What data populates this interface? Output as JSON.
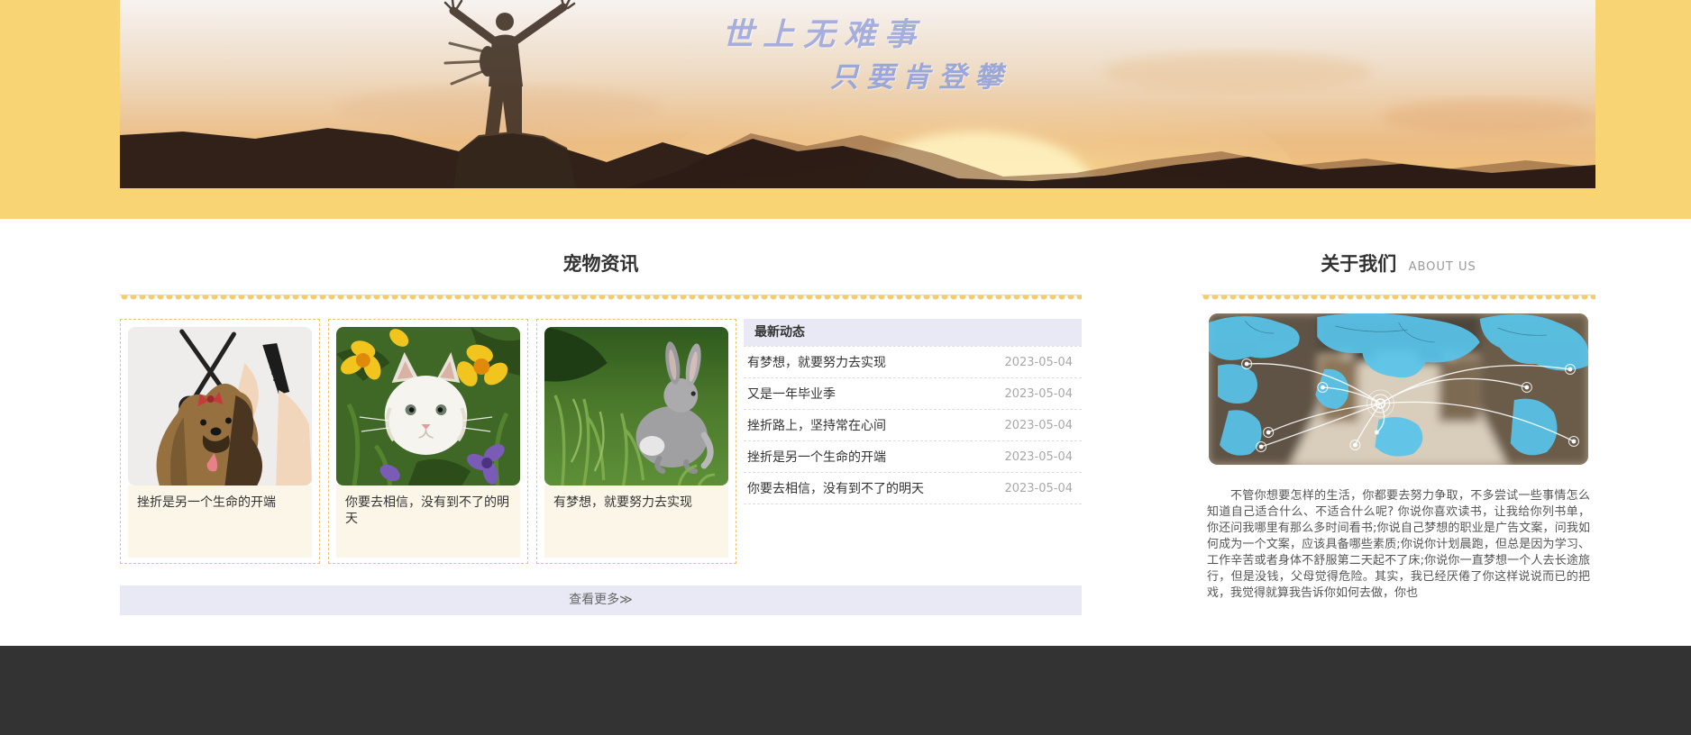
{
  "banner": {
    "slogan_line1": "世上无难事",
    "slogan_line2": "只要肯登攀",
    "image": "hiker-sunset-mountain-photo"
  },
  "pet_news": {
    "title": "宠物资讯",
    "cards": [
      {
        "image": "dog-grooming-photo",
        "caption": "挫折是另一个生命的开端"
      },
      {
        "image": "white-cat-flowers-photo",
        "caption": "你要去相信，没有到不了的明天"
      },
      {
        "image": "gray-rabbit-grass-photo",
        "caption": "有梦想，就要努力去实现"
      }
    ],
    "latest": {
      "header": "最新动态",
      "items": [
        {
          "title": "有梦想，就要努力去实现",
          "date": "2023-05-04"
        },
        {
          "title": "又是一年毕业季",
          "date": "2023-05-04"
        },
        {
          "title": "挫折路上，坚持常在心间",
          "date": "2023-05-04"
        },
        {
          "title": "挫折是另一个生命的开端",
          "date": "2023-05-04"
        },
        {
          "title": "你要去相信，没有到不了的明天",
          "date": "2023-05-04"
        }
      ]
    },
    "more_label": "查看更多≫"
  },
  "about": {
    "title": "关于我们",
    "subtitle": "ABOUT US",
    "image": "world-map-logistics-photo",
    "text": "不管你想要怎样的生活，你都要去努力争取，不多尝试一些事情怎么知道自己适合什么、不适合什么呢? 你说你喜欢读书，让我给你列书单，你还问我哪里有那么多时间看书;你说自己梦想的职业是广告文案，问我如何成为一个文案，应该具备哪些素质;你说你计划晨跑，但总是因为学习、工作辛苦或者身体不舒服第二天起不了床;你说你一直梦想一个人去长途旅行，但是没钱，父母觉得危险。其实，我已经厌倦了你这样说说而已的把戏，我觉得就算我告诉你如何去做，你也"
  },
  "colors": {
    "band_yellow": "#f8d474",
    "lavender": "#e9e9f6",
    "scallop_yellow": "#f3cd6d",
    "card_dashed_border": "#ecc272",
    "card_caption_bg": "#fbf6e7",
    "slogan_blue": "#a6aedd",
    "footer_dark": "#333333"
  }
}
